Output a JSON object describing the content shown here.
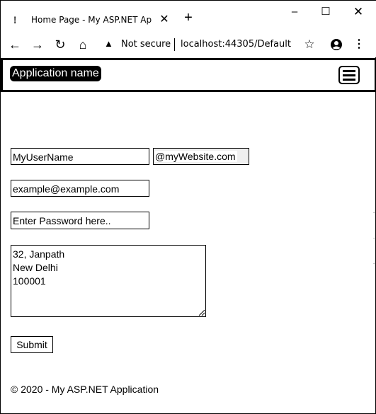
{
  "browser": {
    "tab": {
      "title": "Home Page - My ASP.NET Appli..."
    },
    "window_controls": {
      "minimize": "–",
      "maximize": "☐",
      "close": "✕"
    },
    "toolbar": {
      "security_label": "Not secure",
      "url": "localhost:44305/Default"
    },
    "icons": [
      "favicon-icon",
      "close-icon",
      "plus-icon",
      "back-arrow-icon",
      "forward-arrow-icon",
      "reload-icon",
      "home-icon",
      "warning-icon",
      "star-icon",
      "profile-icon",
      "kebab-menu-icon",
      "hamburger-icon"
    ]
  },
  "navbar": {
    "brand": "Application name"
  },
  "form": {
    "username": "MyUserName",
    "domain_suffix": "@myWebsite.com",
    "email": "example@example.com",
    "password_placeholder": "Enter Password here..",
    "address": "32, Janpath\nNew Delhi\n100001",
    "submit_label": "Submit"
  },
  "footer": {
    "text": "© 2020 - My ASP.NET Application"
  }
}
